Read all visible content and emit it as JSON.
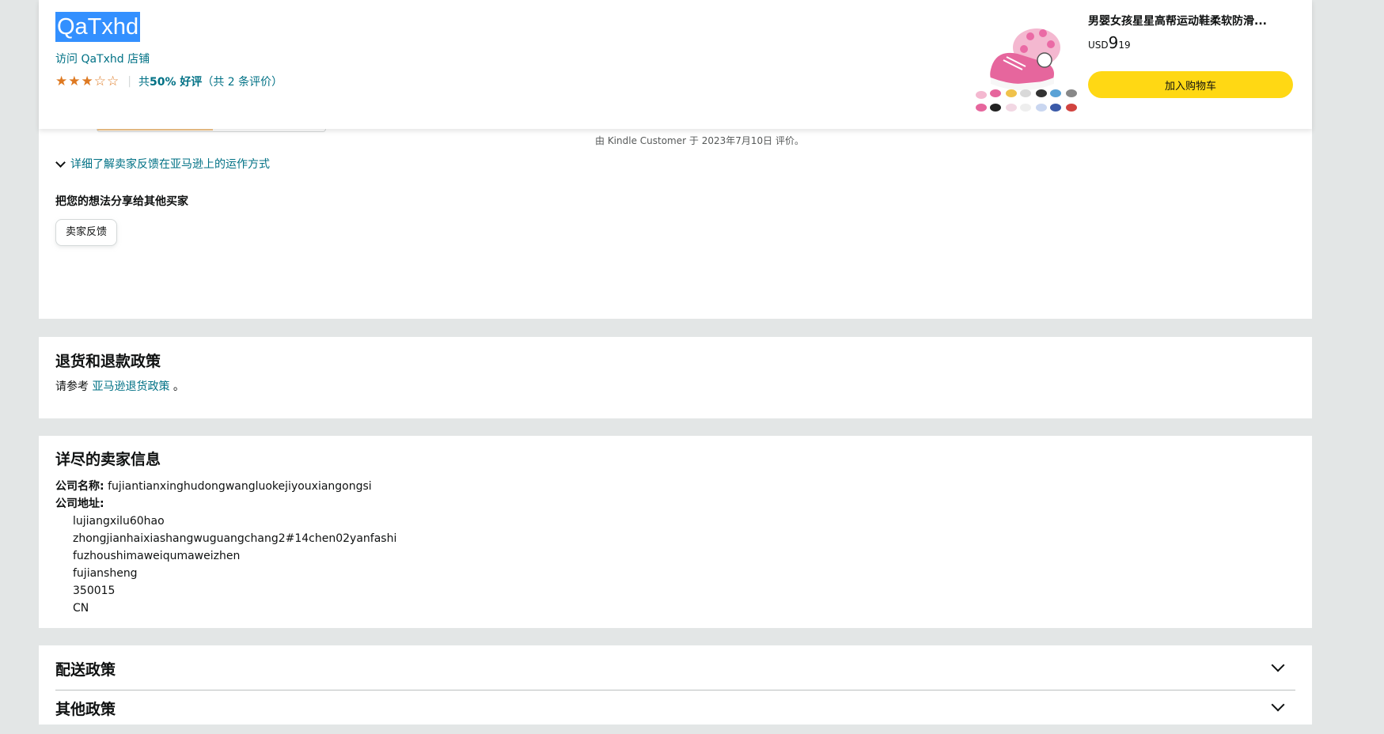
{
  "header": {
    "seller_name": "QaTxhd",
    "visit_store": "访问 QaTxhd 店铺",
    "rating": {
      "stars": 3,
      "max": 5,
      "prefix": "共 ",
      "percent": "50% 好评",
      "count_text": "（共 2 条评价）"
    },
    "product": {
      "title": "男婴女孩星星高帮运动鞋柔软防滑...",
      "currency": "USD",
      "price_whole": "9",
      "price_fraction": "19",
      "add_to_cart": "加入购物车"
    }
  },
  "feedback": {
    "review_byline": "由 Kindle Customer 于 2023年7月10日 评价。",
    "learn_more": "详细了解卖家反馈在亚马逊上的运作方式",
    "share_heading": "把您的想法分享给其他买家",
    "feedback_button": "卖家反馈"
  },
  "returns": {
    "heading": "退货和退款政策",
    "text_prefix": "请参考",
    "link": "亚马逊退货政策",
    "text_suffix": "。"
  },
  "details": {
    "heading": "详尽的卖家信息",
    "company_label": "公司名称:",
    "company_name": "fujiantianxinghudongwangluokejiyouxiangongsi",
    "address_label": "公司地址:",
    "address_lines": [
      "lujiangxilu60hao",
      "zhongjianhaixiashangwuguangchang2#14chen02yanfashi",
      "fuzhoushimaweiqumaweizhen",
      "fujiansheng",
      "350015",
      "CN"
    ]
  },
  "policies": [
    {
      "label": "配送政策"
    },
    {
      "label": "其他政策"
    }
  ],
  "colors": {
    "link": "#007185",
    "star": "#de7921",
    "cart_button": "#ffd814",
    "selection": "#3390ff"
  }
}
